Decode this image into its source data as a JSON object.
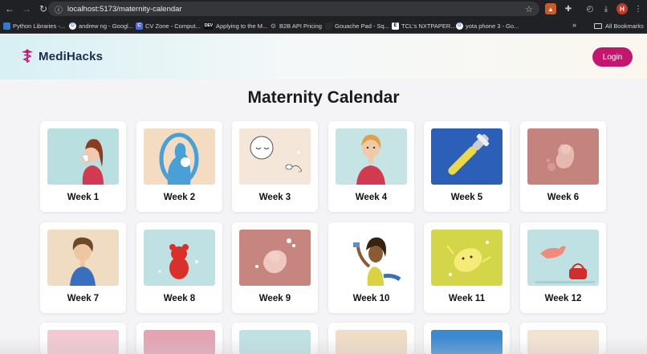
{
  "browser": {
    "url": "localhost:5173/maternity-calendar",
    "bookmarks": [
      {
        "label": "Python Libraries -...",
        "color": "#3b78c4",
        "glyph": "P"
      },
      {
        "label": "andrew ng - Googl...",
        "color": "#ffffff",
        "glyph": "G"
      },
      {
        "label": "CV Zone - Comput...",
        "color": "#4a6fd6",
        "glyph": "C"
      },
      {
        "label": "Applying to the M...",
        "color": "#111111",
        "glyph": "DEV"
      },
      {
        "label": "B2B API Pricing",
        "color": "#9aa0a6",
        "glyph": "⚙"
      },
      {
        "label": "Gouache Pad - Sq...",
        "color": "#2a2a2a",
        "glyph": ""
      },
      {
        "label": "TCL's NXTPAPER...",
        "color": "#111111",
        "glyph": "E"
      },
      {
        "label": "yota phone 3 - Go...",
        "color": "#ffffff",
        "glyph": "G"
      }
    ],
    "all_bookmarks_label": "All Bookmarks",
    "avatar_letter": "H"
  },
  "header": {
    "logo_text": "MediHacks",
    "login_label": "Login"
  },
  "page": {
    "title": "Maternity Calendar"
  },
  "weeks": [
    {
      "label": "Week 1",
      "bg": "#b9dfe1",
      "icon": "woman-drinking-icon"
    },
    {
      "label": "Week 2",
      "bg": "#f3dcc2",
      "icon": "mother-silhouette-icon"
    },
    {
      "label": "Week 3",
      "bg": "#f4e6d9",
      "icon": "egg-sperm-icon"
    },
    {
      "label": "Week 4",
      "bg": "#c6e4e3",
      "icon": "woman-worried-icon"
    },
    {
      "label": "Week 5",
      "bg": "#2c5fb8",
      "icon": "toothbrush-icon"
    },
    {
      "label": "Week 6",
      "bg": "#c4837c",
      "icon": "embryo-icon"
    },
    {
      "label": "Week 7",
      "bg": "#f0dcc3",
      "icon": "woman-short-hair-icon"
    },
    {
      "label": "Week 8",
      "bg": "#bfe1e3",
      "icon": "gummy-bear-icon"
    },
    {
      "label": "Week 9",
      "bg": "#c6867f",
      "icon": "fetus-icon"
    },
    {
      "label": "Week 10",
      "bg": "#ffffff",
      "icon": "woman-stretching-icon"
    },
    {
      "label": "Week 11",
      "bg": "#d4d64a",
      "icon": "lemon-icon"
    },
    {
      "label": "Week 12",
      "bg": "#bfe1e3",
      "icon": "cat-handbag-icon"
    }
  ],
  "partial_weeks": [
    {
      "bg": "#f2c8d2",
      "icon": "flowers-icon"
    },
    {
      "bg": "#e5a3b3",
      "icon": "bra-icon"
    },
    {
      "bg": "#bfe1e3",
      "icon": "sprout-icon"
    },
    {
      "bg": "#f1dcc6",
      "icon": "two-women-icon"
    },
    {
      "bg": "#3b8ad1",
      "icon": "baby-icon"
    },
    {
      "bg": "#f3e3d1",
      "icon": "hands-icon"
    }
  ]
}
